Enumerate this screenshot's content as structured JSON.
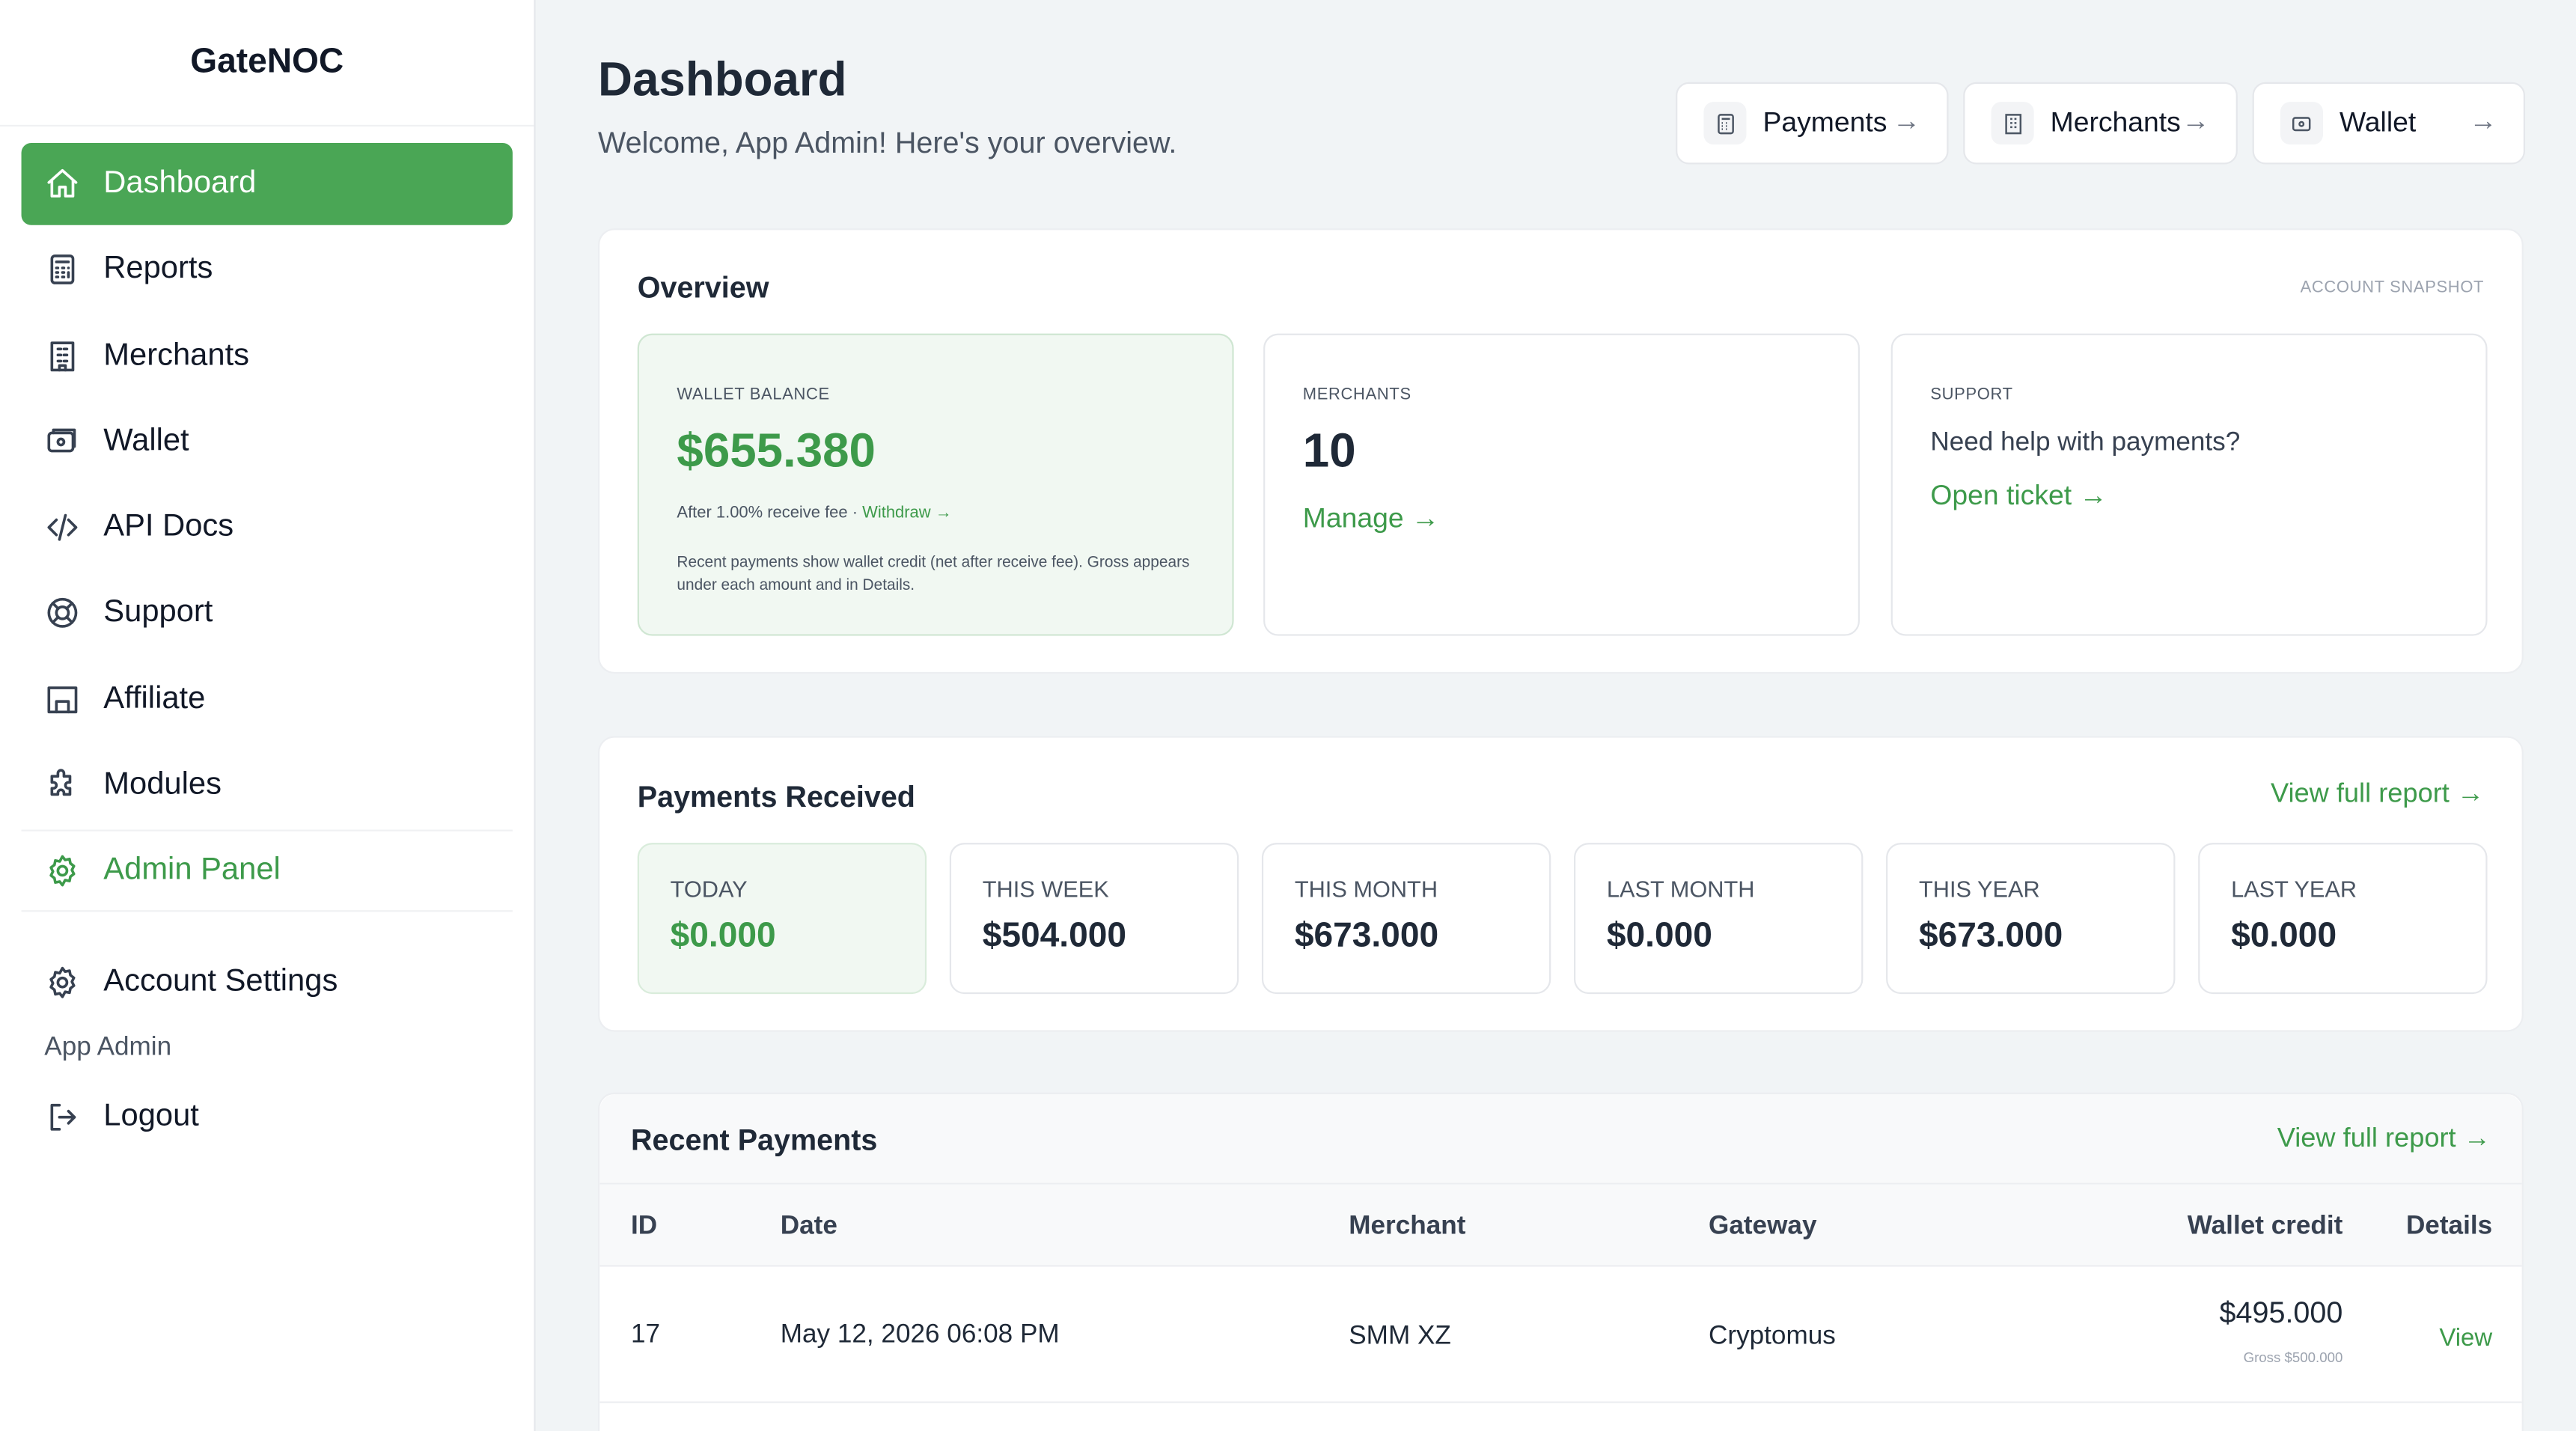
{
  "brand": "GateNOC",
  "nav": {
    "dashboard": "Dashboard",
    "reports": "Reports",
    "merchants": "Merchants",
    "wallet": "Wallet",
    "api_docs": "API Docs",
    "support": "Support",
    "affiliate": "Affiliate",
    "modules": "Modules",
    "admin_panel": "Admin Panel",
    "account_settings": "Account Settings",
    "user_name": "App Admin",
    "logout": "Logout"
  },
  "header": {
    "title": "Dashboard",
    "subtitle": "Welcome, App Admin! Here's your overview.",
    "quick_links": [
      "Payments",
      "Merchants",
      "Wallet"
    ],
    "arrow": "→"
  },
  "overview": {
    "title": "Overview",
    "snapshot_label": "ACCOUNT SNAPSHOT",
    "wallet": {
      "label": "WALLET BALANCE",
      "amount": "$655.380",
      "fee_text": "After 1.00% receive fee · ",
      "withdraw": "Withdraw →",
      "note": "Recent payments show wallet credit (net after receive fee). Gross appears under each amount and in Details."
    },
    "merchants": {
      "label": "MERCHANTS",
      "count": "10",
      "manage": "Manage →"
    },
    "support": {
      "label": "SUPPORT",
      "text": "Need help with payments?",
      "link": "Open ticket →"
    }
  },
  "payments_received": {
    "title": "Payments Received",
    "link": "View full report →",
    "stats": [
      {
        "label": "TODAY",
        "value": "$0.000"
      },
      {
        "label": "THIS WEEK",
        "value": "$504.000"
      },
      {
        "label": "THIS MONTH",
        "value": "$673.000"
      },
      {
        "label": "LAST MONTH",
        "value": "$0.000"
      },
      {
        "label": "THIS YEAR",
        "value": "$673.000"
      },
      {
        "label": "LAST YEAR",
        "value": "$0.000"
      }
    ]
  },
  "recent_payments": {
    "title": "Recent Payments",
    "link": "View full report →",
    "columns": [
      "ID",
      "Date",
      "Merchant",
      "Gateway",
      "Wallet credit",
      "Details"
    ],
    "rows": [
      {
        "id": "17",
        "date": "May 12, 2026 06:08 PM",
        "merchant": "SMM XZ",
        "gateway": "Cryptomus",
        "credit": "$495.000",
        "gross": "Gross $500.000",
        "details": "View"
      }
    ]
  },
  "colors": {
    "accent": "#4aa655",
    "accent_text": "#3d9a4a",
    "background": "#f1f4f6"
  }
}
